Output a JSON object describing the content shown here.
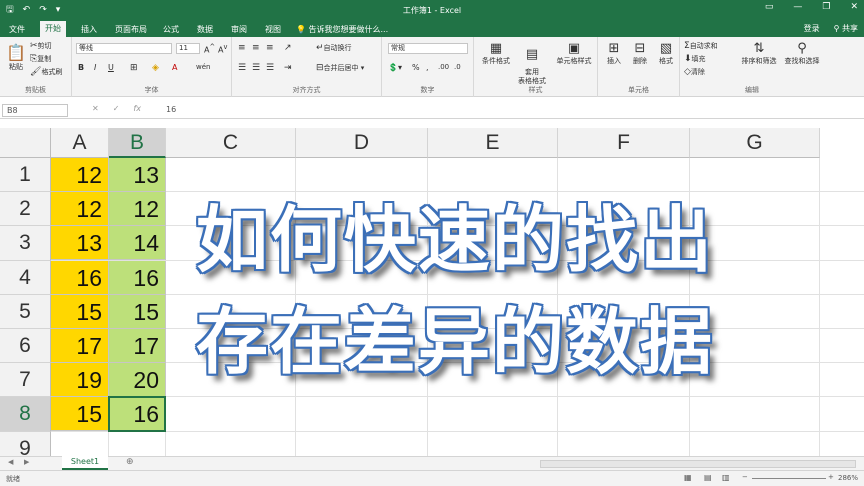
{
  "window": {
    "title": "工作簿1 - Excel",
    "login": "登录",
    "share": "共享"
  },
  "tabs": [
    "文件",
    "开始",
    "插入",
    "页面布局",
    "公式",
    "数据",
    "审阅",
    "视图"
  ],
  "active_tab": "开始",
  "tell_me": "告诉我您想要做什么...",
  "ribbon": {
    "clipboard": {
      "paste": "粘贴",
      "cut": "剪切",
      "copy": "复制",
      "format_painter": "格式刷",
      "label": "剪贴板"
    },
    "font": {
      "name": "等线",
      "size": "11",
      "label": "字体"
    },
    "alignment": {
      "wrap": "自动换行",
      "merge": "合并后居中",
      "label": "对齐方式"
    },
    "number": {
      "format": "常规",
      "label": "数字"
    },
    "styles": {
      "conditional": "条件格式",
      "table": "套用\n表格格式",
      "cell": "单元格样式",
      "label": "样式"
    },
    "cells": {
      "insert": "插入",
      "delete": "删除",
      "format": "格式",
      "label": "单元格"
    },
    "editing": {
      "autosum": "自动求和",
      "fill": "填充",
      "clear": "清除",
      "sort": "排序和筛选",
      "find": "查找和选择",
      "label": "编辑"
    }
  },
  "formula_bar": {
    "name_box": "B8",
    "value": "16"
  },
  "columns": [
    "A",
    "B",
    "C",
    "D",
    "E",
    "F",
    "G"
  ],
  "rows": [
    "1",
    "2",
    "3",
    "4",
    "5",
    "6",
    "7",
    "8",
    "9"
  ],
  "cells": {
    "A": [
      "12",
      "12",
      "13",
      "16",
      "15",
      "17",
      "19",
      "15"
    ],
    "B": [
      "13",
      "12",
      "14",
      "16",
      "15",
      "17",
      "20",
      "16"
    ]
  },
  "overlay": {
    "line1": "如何快速的找出",
    "line2": "存在差异的数据"
  },
  "sheet_tab": "Sheet1",
  "status": {
    "ready": "就绪",
    "zoom": "286%"
  },
  "colors": {
    "excel_green": "#217346",
    "col_a_fill": "#ffd700",
    "col_b_fill": "#bde07a",
    "overlay_outline": "#3b6fb8"
  }
}
